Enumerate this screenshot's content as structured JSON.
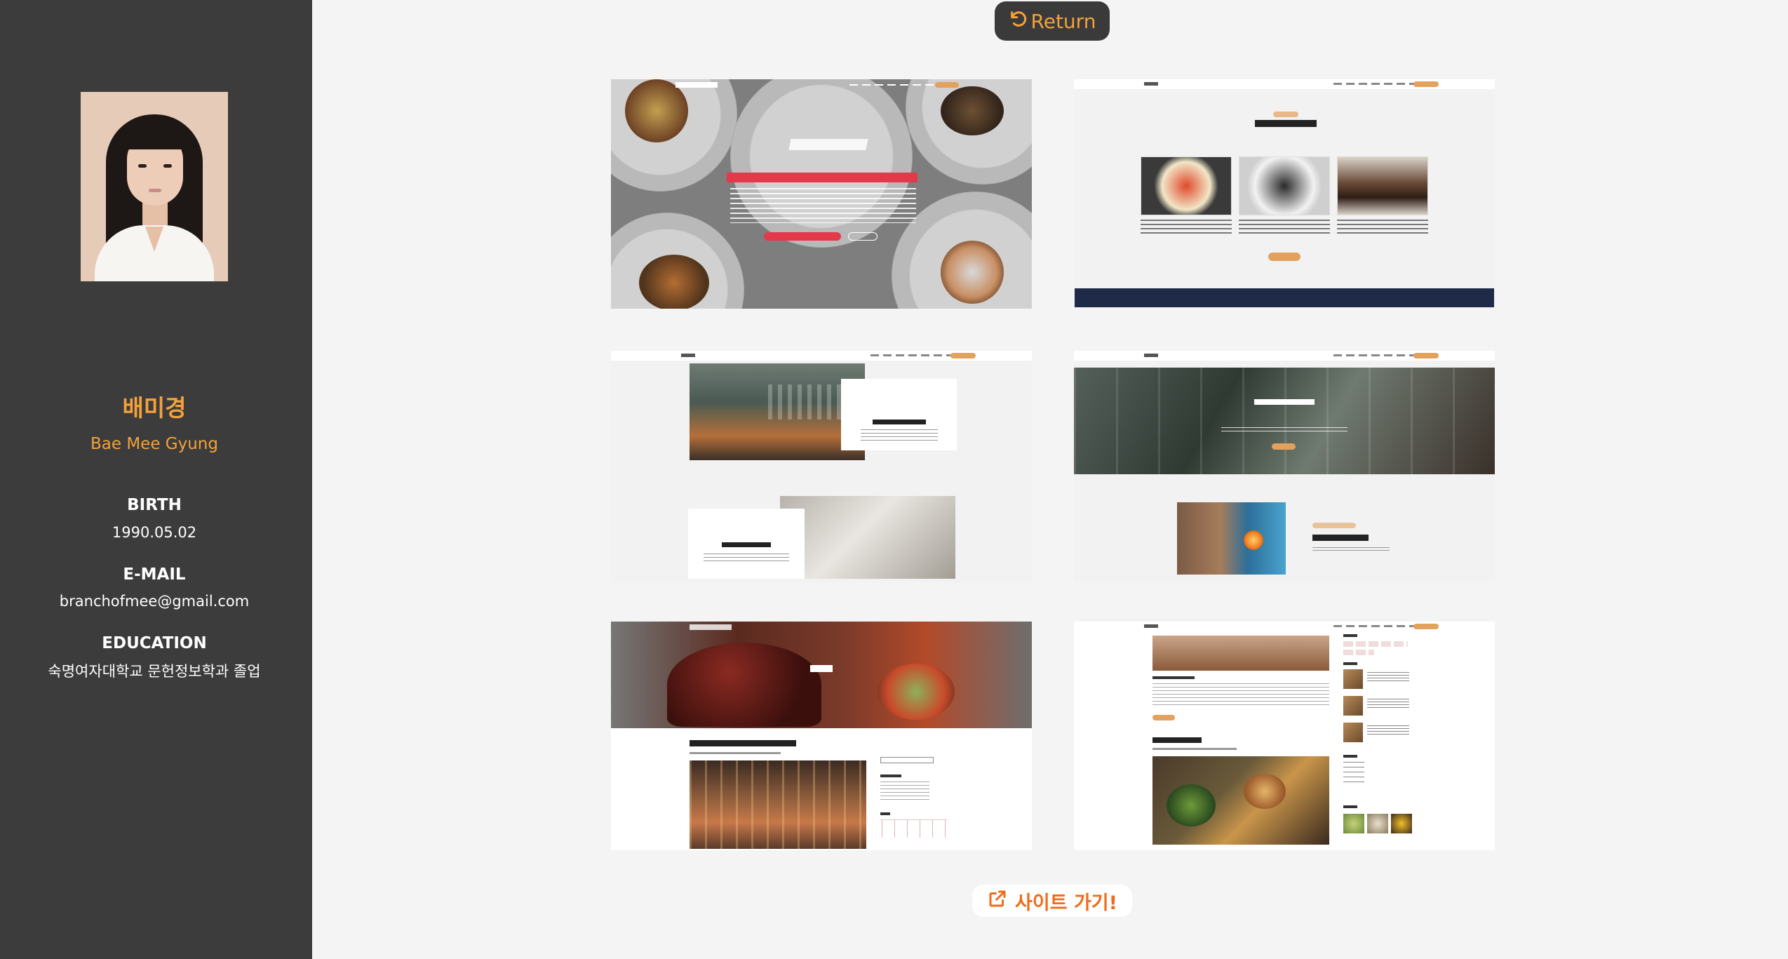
{
  "profile": {
    "name_ko": "배미경",
    "name_en": "Bae Mee Gyung",
    "birth_label": "BIRTH",
    "birth_value": "1990.05.02",
    "email_label": "E-MAIL",
    "email_value": "branchofmee@gmail.com",
    "education_label": "EDUCATION",
    "education_value": "숙명여자대학교 문헌정보학과 졸업"
  },
  "header": {
    "return_label": "Return",
    "return_icon": "undo-arrow-icon"
  },
  "gallery": {
    "thumbnails": [
      {
        "name": "home-hero"
      },
      {
        "name": "special-dishes"
      },
      {
        "name": "interior-fresh-food"
      },
      {
        "name": "book-table-made-with-love"
      },
      {
        "name": "blog-list"
      },
      {
        "name": "blog-sidebar"
      }
    ]
  },
  "footer": {
    "site_link_label": "사이트 가기!",
    "site_link_icon": "external-link-icon"
  },
  "colors": {
    "sidebar_bg": "#3c3c3c",
    "accent_orange": "#f4a23b",
    "link_orange": "#f06a1a",
    "page_bg": "#f4f4f4"
  }
}
